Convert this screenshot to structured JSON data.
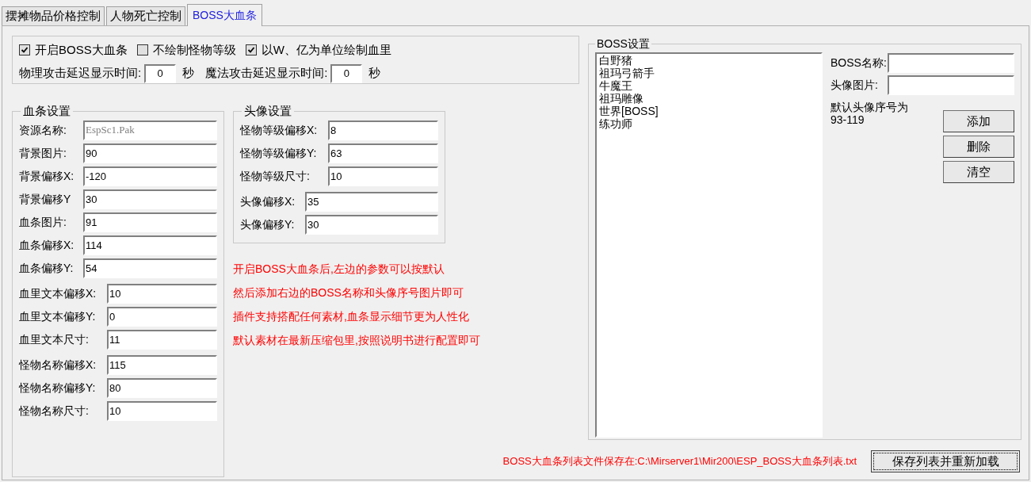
{
  "tabs": [
    {
      "label": "摆摊物品价格控制",
      "selected": false
    },
    {
      "label": "人物死亡控制",
      "selected": false
    },
    {
      "label": "BOSS大血条",
      "selected": true
    }
  ],
  "options": {
    "checkboxes": [
      {
        "label": "开启BOSS大血条",
        "checked": true
      },
      {
        "label": "不绘制怪物等级",
        "checked": false
      },
      {
        "label": "以W、亿为单位绘制血里",
        "checked": true
      }
    ],
    "delays": [
      {
        "label": "物理攻击延迟显示时间:",
        "value": "0",
        "unit": "秒"
      },
      {
        "label": "魔法攻击延迟显示时间:",
        "value": "0",
        "unit": "秒"
      }
    ]
  },
  "blood_bar_settings": {
    "title": "血条设置",
    "sections": [
      [
        {
          "label": "资源名称:",
          "value": "EspSc1.Pak",
          "disabled": true
        },
        {
          "label": "背景图片:",
          "value": "90",
          "disabled": false
        },
        {
          "label": "背景偏移X:",
          "value": "-120",
          "disabled": false
        },
        {
          "label": "背景偏移Y",
          "value": "30",
          "disabled": false
        },
        {
          "label": "血条图片:",
          "value": "91",
          "disabled": false
        },
        {
          "label": "血条偏移X:",
          "value": "114",
          "disabled": false
        },
        {
          "label": "血条偏移Y:",
          "value": "54",
          "disabled": false
        }
      ],
      [
        {
          "label": "血里文本偏移X:",
          "value": "10",
          "disabled": false
        },
        {
          "label": "血里文本偏移Y:",
          "value": "0",
          "disabled": false
        },
        {
          "label": "血里文本尺寸:",
          "value": "11",
          "disabled": false
        }
      ],
      [
        {
          "label": "怪物名称偏移X:",
          "value": "115",
          "disabled": false
        },
        {
          "label": "怪物名称偏移Y:",
          "value": "80",
          "disabled": false
        },
        {
          "label": "怪物名称尺寸:",
          "value": "10",
          "disabled": false
        }
      ]
    ]
  },
  "avatar_settings": {
    "title": "头像设置",
    "sections": [
      [
        {
          "label": "怪物等级偏移X:",
          "value": "8",
          "disabled": false
        },
        {
          "label": "怪物等级偏移Y:",
          "value": "63",
          "disabled": false
        },
        {
          "label": "怪物等级尺寸:",
          "value": "10",
          "disabled": false
        }
      ],
      [
        {
          "label": "头像偏移X:",
          "value": "35",
          "disabled": false
        },
        {
          "label": "头像偏移Y:",
          "value": "30",
          "disabled": false
        }
      ]
    ]
  },
  "notes": [
    "开启BOSS大血条后,左边的参数可以按默认",
    "然后添加右边的BOSS名称和头像序号图片即可",
    "插件支持搭配任何素材,血条显示细节更为人性化",
    "默认素材在最新压缩包里,按照说明书进行配置即可"
  ],
  "boss_settings": {
    "title": "BOSS设置",
    "list": [
      "白野猪",
      "祖玛弓箭手",
      "牛魔王",
      "祖玛雕像",
      "世界[BOSS]",
      "练功师"
    ],
    "fields": [
      {
        "label": "BOSS名称:"
      },
      {
        "label": "头像图片:"
      }
    ],
    "hint": [
      "默认头像序号为",
      "93-119"
    ],
    "buttons": [
      "添加",
      "删除",
      "清空"
    ]
  },
  "footer": {
    "path_note": "BOSS大血条列表文件保存在:C:\\Mirserver1\\Mir200\\ESP_BOSS大血条列表.txt",
    "button": "保存列表并重新加载"
  }
}
